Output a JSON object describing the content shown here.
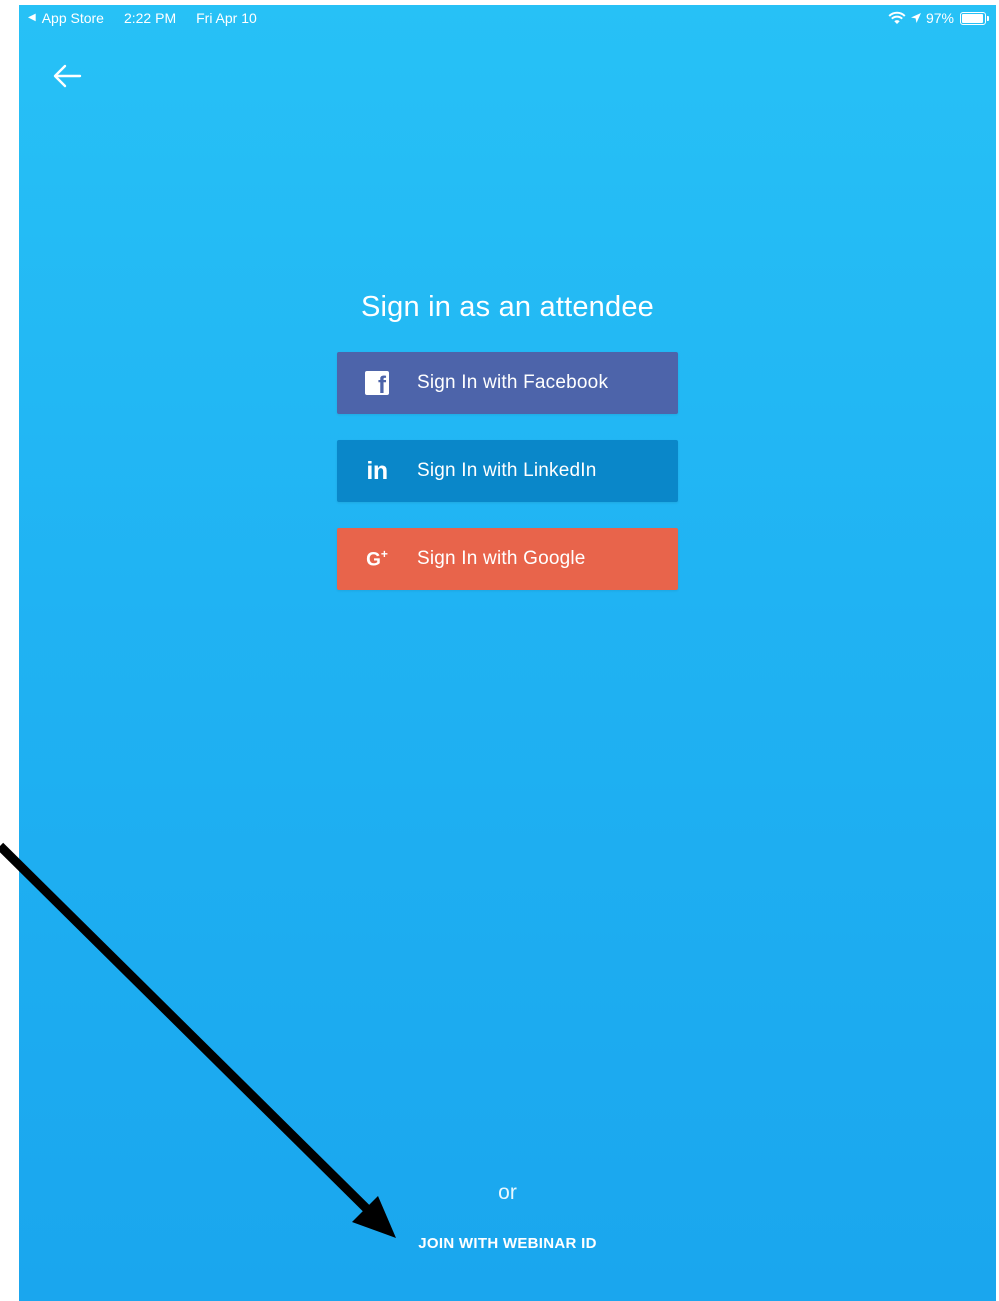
{
  "status_bar": {
    "back_app": "App Store",
    "time": "2:22 PM",
    "date": "Fri Apr 10",
    "battery_percent": "97%",
    "battery_level": 0.97
  },
  "title": "Sign in as an attendee",
  "buttons": {
    "facebook": {
      "label": "Sign In with Facebook",
      "color": "#4d64aa",
      "icon": "facebook-icon"
    },
    "linkedin": {
      "label": "Sign In with LinkedIn",
      "color": "#0a87c9",
      "icon": "linkedin-icon"
    },
    "google": {
      "label": "Sign In with Google",
      "color": "#e8644b",
      "icon": "google-plus-icon"
    }
  },
  "or_label": "or",
  "join_link": "JOIN WITH WEBINAR ID",
  "colors": {
    "background_top": "#27c1f6",
    "background_bottom": "#1aa6ee",
    "annotation_arrow": "#000000"
  }
}
